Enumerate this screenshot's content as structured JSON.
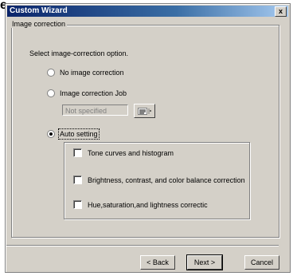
{
  "fragment_text": "e",
  "window": {
    "title": "Custom Wizard",
    "close_glyph": "x"
  },
  "group": {
    "label": "Image correction",
    "prompt": "Select image-correction option."
  },
  "options": {
    "no_correction": "No image correction",
    "correction_job": "Image correction Job",
    "job_field_value": "Not specified",
    "auto_setting": "Auto setting"
  },
  "auto_checks": [
    {
      "label": "Tone curves and histogram",
      "checked": false
    },
    {
      "label": "Brightness, contrast, and color balance correction",
      "checked": false
    },
    {
      "label": "Hue,saturation,and lightness correctic",
      "checked": false
    }
  ],
  "buttons": {
    "back": "< Back",
    "next": "Next >",
    "cancel": "Cancel"
  },
  "selected_option": "auto_setting",
  "colors": {
    "title_start": "#0a246a",
    "title_end": "#a6caf0",
    "dialog_bg": "#d4d0c8"
  },
  "icons": {
    "picker": "list-picker-icon"
  }
}
